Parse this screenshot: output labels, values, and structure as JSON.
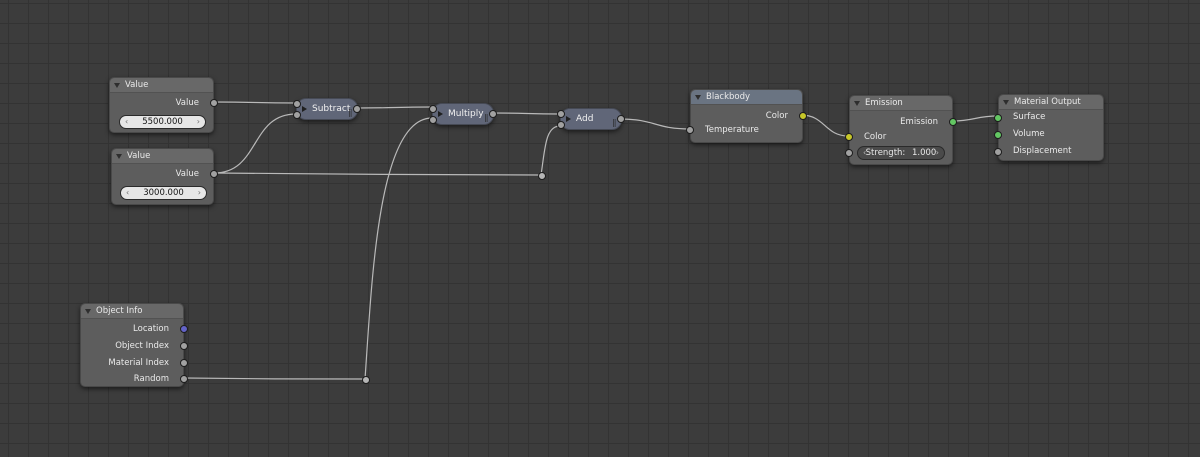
{
  "editor": "Shader Node Editor",
  "nodes": {
    "value1": {
      "title": "Value",
      "output": "Value",
      "field_value": "5500.000"
    },
    "value2": {
      "title": "Value",
      "output": "Value",
      "field_value": "3000.000"
    },
    "subtract": {
      "label": "Subtract"
    },
    "multiply": {
      "label": "Multiply"
    },
    "add": {
      "label": "Add"
    },
    "blackbody": {
      "title": "Blackbody",
      "output": "Color",
      "input": "Temperature"
    },
    "emission": {
      "title": "Emission",
      "output": "Emission",
      "input_color": "Color",
      "strength_label": "Strength:",
      "strength_value": "1.000"
    },
    "material_output": {
      "title": "Material Output",
      "inputs": [
        "Surface",
        "Volume",
        "Displacement"
      ]
    },
    "object_info": {
      "title": "Object Info",
      "outputs": [
        "Location",
        "Object Index",
        "Material Index",
        "Random"
      ]
    }
  },
  "colors": {
    "background": "#3c3c3c",
    "node_body": "#5d5d5d",
    "math_node": "#606678",
    "socket_gray": "#a1a1a1",
    "socket_yellow": "#c7c729",
    "socket_green": "#63c763",
    "socket_blue": "#6363c7",
    "wire": "#c8c8c8"
  }
}
